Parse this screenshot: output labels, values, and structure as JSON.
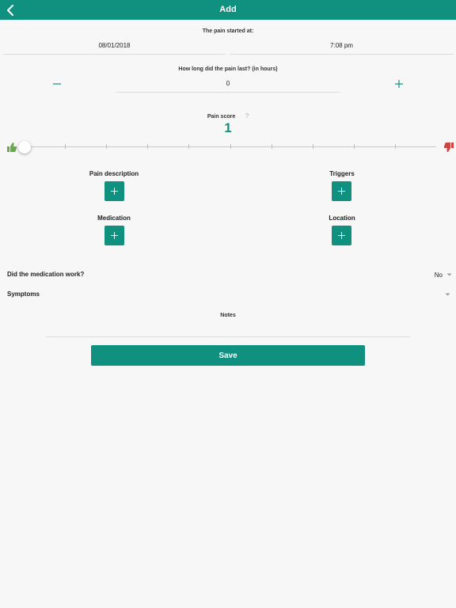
{
  "header": {
    "title": "Add",
    "back_icon": "chevron-left-icon"
  },
  "start": {
    "label": "The pain started at:",
    "date": "08/01/2018",
    "time": "7:08 pm"
  },
  "duration": {
    "label": "How long did the pain last? (in hours)",
    "value": "0"
  },
  "pain_score": {
    "label": "Pain score",
    "help": "?",
    "value": "1",
    "slider_level": 0.0,
    "good_icon": "thumbs-up-icon",
    "bad_icon": "thumbs-down-icon",
    "accent_color": "#10907e",
    "good_color": "#6aa84f",
    "bad_color": "#cc4444"
  },
  "sections": {
    "pain_description": "Pain description",
    "triggers": "Triggers",
    "medication": "Medication",
    "location": "Location"
  },
  "medication_work": {
    "label": "Did the medication work?",
    "value": "No"
  },
  "symptoms": {
    "label": "Symptoms"
  },
  "notes": {
    "label": "Notes"
  },
  "save": {
    "label": "Save"
  }
}
